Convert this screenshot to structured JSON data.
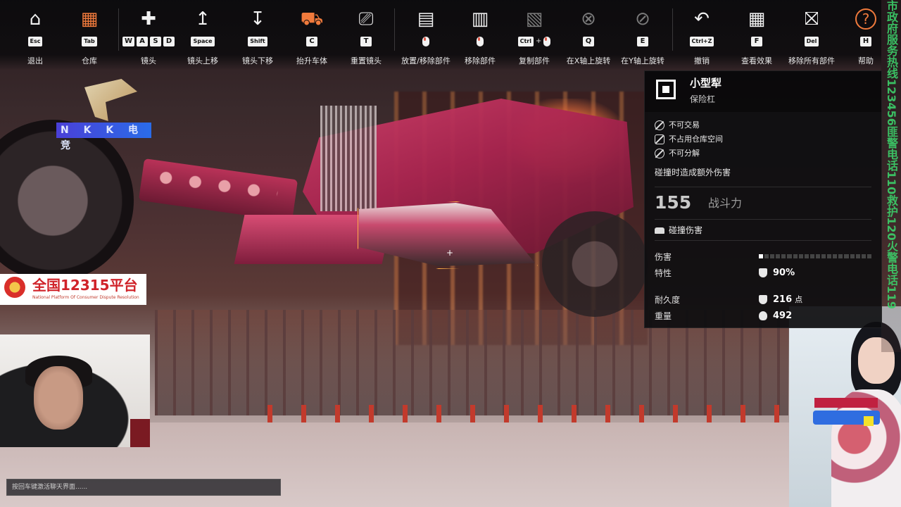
{
  "toolbar": {
    "items": [
      {
        "id": "exit",
        "label": "退出",
        "keys": [
          "Esc"
        ],
        "icon": "garage-icon"
      },
      {
        "id": "warehouse",
        "label": "仓库",
        "keys": [
          "Tab"
        ],
        "icon": "crate-icon"
      },
      {
        "id": "camera",
        "label": "镜头",
        "keys": [
          "W",
          "A",
          "S",
          "D"
        ],
        "icon": "move-icon"
      },
      {
        "id": "camera-up",
        "label": "镜头上移",
        "keys": [
          "Space"
        ],
        "icon": "arrow-up-icon"
      },
      {
        "id": "camera-down",
        "label": "镜头下移",
        "keys": [
          "Shift"
        ],
        "icon": "arrow-down-icon"
      },
      {
        "id": "lift",
        "label": "抬升车体",
        "keys": [
          "C"
        ],
        "icon": "lift-car-icon"
      },
      {
        "id": "reset-camera",
        "label": "重置镜头",
        "keys": [
          "T"
        ],
        "icon": "reset-camera-icon"
      },
      {
        "id": "place",
        "label": "放置/移除部件",
        "keys": [
          "mouse-left"
        ],
        "icon": "place-part-icon"
      },
      {
        "id": "remove",
        "label": "移除部件",
        "keys": [
          "mouse-right"
        ],
        "icon": "remove-part-icon"
      },
      {
        "id": "copy",
        "label": "复制部件",
        "keys": [
          "Ctrl",
          "+",
          "mouse-left"
        ],
        "icon": "copy-part-icon"
      },
      {
        "id": "rotate-x",
        "label": "在X轴上旋转",
        "keys": [
          "Q"
        ],
        "icon": "rotate-x-icon"
      },
      {
        "id": "rotate-y",
        "label": "在Y轴上旋转",
        "keys": [
          "E"
        ],
        "icon": "rotate-y-icon"
      },
      {
        "id": "undo",
        "label": "撤销",
        "keys": [
          "Ctrl+Z"
        ],
        "icon": "undo-icon"
      },
      {
        "id": "view",
        "label": "查看效果",
        "keys": [
          "F"
        ],
        "icon": "grid-view-icon"
      },
      {
        "id": "remove-all",
        "label": "移除所有部件",
        "keys": [
          "Del"
        ],
        "icon": "remove-all-icon"
      },
      {
        "id": "help",
        "label": "帮助",
        "keys": [
          "H"
        ],
        "icon": "help-icon"
      }
    ]
  },
  "overlay": {
    "team_logo_text": "N K K 电 竞",
    "badge_title": "全国12315平台",
    "badge_subtitle": "National Platform Of Consumer Dispute Resolution",
    "side_ticker": "市政府服务热线123456匪警电话110救护120火警电话119"
  },
  "panel": {
    "name": "小型犁",
    "type": "保险杠",
    "properties": [
      "不可交易",
      "不占用仓库空间",
      "不可分解"
    ],
    "description": "碰撞时造成额外伤害",
    "power_value": "155",
    "power_label": "战斗力",
    "damage_title": "碰撞伤害",
    "stats": {
      "damage_label": "伤害",
      "damage_level": 0.05,
      "trait_label": "特性",
      "trait_value": "90%",
      "durability_label": "耐久度",
      "durability_value": "216",
      "durability_unit": "点",
      "weight_label": "重量",
      "weight_value": "492"
    }
  },
  "chat": {
    "placeholder": "按回车键激活聊天界面......"
  },
  "colors": {
    "accent_orange": "#f07a3c",
    "selection_outline": "#ffb04a",
    "panel_bg": "#0e0e10"
  }
}
